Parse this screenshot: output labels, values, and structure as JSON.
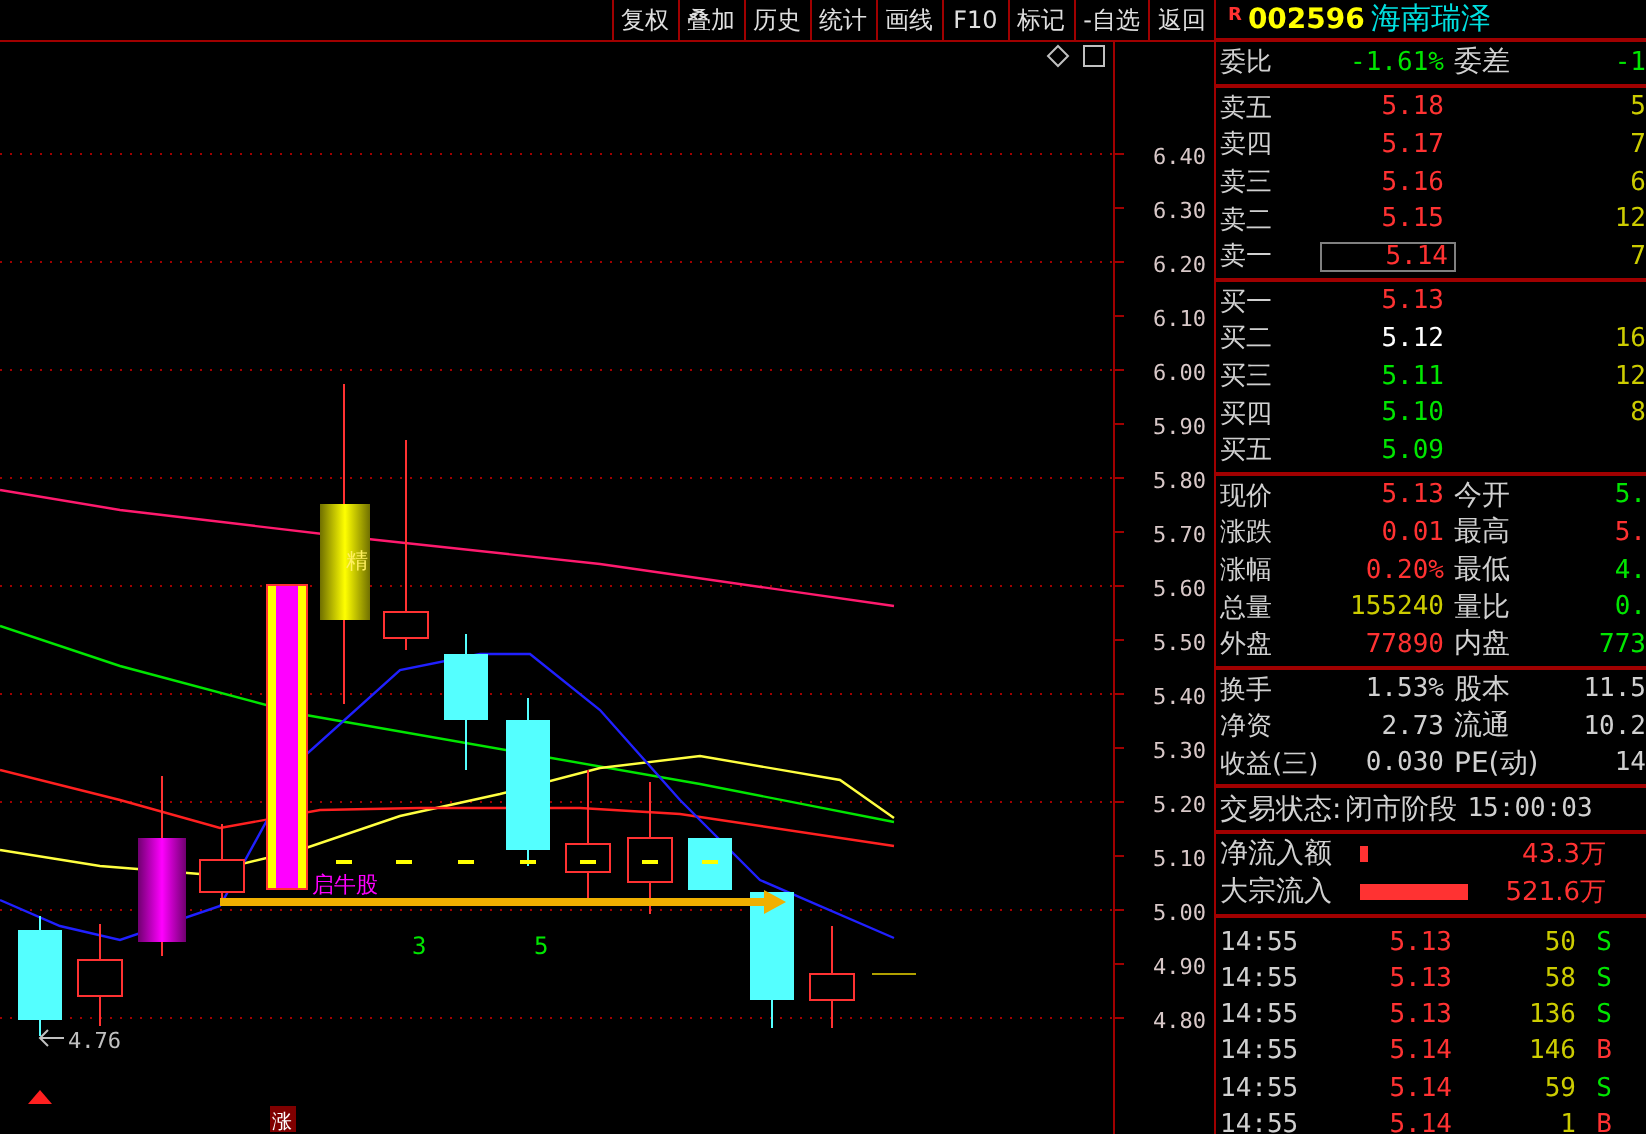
{
  "toolbar": [
    "复权",
    "叠加",
    "历史",
    "统计",
    "画线",
    "F10",
    "标记",
    "-自选",
    "返回"
  ],
  "chart": {
    "axis_labels": [
      "6.40",
      "6.30",
      "6.20",
      "6.10",
      "6.00",
      "5.90",
      "5.80",
      "5.70",
      "5.60",
      "5.50",
      "5.40",
      "5.30",
      "5.20",
      "5.10",
      "5.00",
      "4.90",
      "4.80"
    ],
    "low_label": "4.76",
    "signal_label": "启牛股",
    "candle_mark": "精",
    "counts": [
      "3",
      "5"
    ],
    "badge": "涨"
  },
  "quote": {
    "flag": "R",
    "code": "002596",
    "name": "海南瑞泽"
  },
  "ratio": {
    "label": "委比",
    "value": "-1.61%",
    "label2": "委差",
    "value2": "-1"
  },
  "asks": [
    {
      "label": "卖五",
      "price": "5.18",
      "color": "#ff3232",
      "volume": "5",
      "selected": false
    },
    {
      "label": "卖四",
      "price": "5.17",
      "color": "#ff3232",
      "volume": "7",
      "selected": false
    },
    {
      "label": "卖三",
      "price": "5.16",
      "color": "#ff3232",
      "volume": "6",
      "selected": false
    },
    {
      "label": "卖二",
      "price": "5.15",
      "color": "#ff3232",
      "volume": "12",
      "selected": false
    },
    {
      "label": "卖一",
      "price": "5.14",
      "color": "#ff3232",
      "volume": "7",
      "selected": true
    }
  ],
  "bids": [
    {
      "label": "买一",
      "price": "5.13",
      "color": "#ff3232",
      "selected": false
    },
    {
      "label": "买二",
      "price": "5.12",
      "color": "#ffffff",
      "volume": "16",
      "selected": false
    },
    {
      "label": "买三",
      "price": "5.11",
      "color": "#00e600",
      "volume": "12",
      "selected": false
    },
    {
      "label": "买四",
      "price": "5.10",
      "color": "#00e600",
      "volume": "8",
      "selected": false
    },
    {
      "label": "买五",
      "price": "5.09",
      "color": "#00e600",
      "selected": false
    }
  ],
  "stats": [
    {
      "label": "现价",
      "value": "5.13",
      "color": "#ff3232",
      "right": {
        "label": "今开",
        "value": "5.",
        "color": "#00e600"
      }
    },
    {
      "label": "涨跌",
      "value": "0.01",
      "color": "#ff3232",
      "right": {
        "label": "最高",
        "value": "5.",
        "color": "#ff3232"
      }
    },
    {
      "label": "涨幅",
      "value": "0.20%",
      "color": "#ff3232",
      "right": {
        "label": "最低",
        "value": "4.",
        "color": "#00e600"
      }
    },
    {
      "label": "总量",
      "value": "155240",
      "color": "#cccc00",
      "right": {
        "label": "量比",
        "value": "0.",
        "color": "#00e600"
      }
    },
    {
      "label": "外盘",
      "value": "77890",
      "color": "#ff3232",
      "right": {
        "label": "内盘",
        "value": "773",
        "color": "#00e600"
      }
    }
  ],
  "fundamentals": [
    {
      "label": "换手",
      "value": "1.53%",
      "label2": "股本",
      "value2": "11.5"
    },
    {
      "label": "净资",
      "value": "2.73",
      "label2": "流通",
      "value2": "10.2"
    },
    {
      "label": "收益(三)",
      "value": "0.030",
      "label2": "PE(动)",
      "value2": "14"
    }
  ],
  "status": {
    "label": "交易状态:",
    "value": "闭市阶段",
    "time": "15:00:03"
  },
  "flows": [
    {
      "label": "净流入额",
      "value": "43.3万"
    },
    {
      "label": "大宗流入",
      "value": "521.6万"
    }
  ],
  "trades": [
    {
      "time": "14:55",
      "price": "5.13",
      "volume": "50",
      "side": "S",
      "kind": "sell"
    },
    {
      "time": "14:55",
      "price": "5.13",
      "volume": "58",
      "side": "S",
      "kind": "sell"
    },
    {
      "time": "14:55",
      "price": "5.13",
      "volume": "136",
      "side": "S",
      "kind": "sell"
    },
    {
      "time": "14:55",
      "price": "5.14",
      "volume": "146",
      "side": "B",
      "kind": "buy"
    },
    {
      "time": "14:55",
      "price": "5.14",
      "volume": "59",
      "side": "S",
      "kind": "sell"
    },
    {
      "time": "14:55",
      "price": "5.14",
      "volume": "1",
      "side": "B",
      "kind": "buy"
    }
  ]
}
